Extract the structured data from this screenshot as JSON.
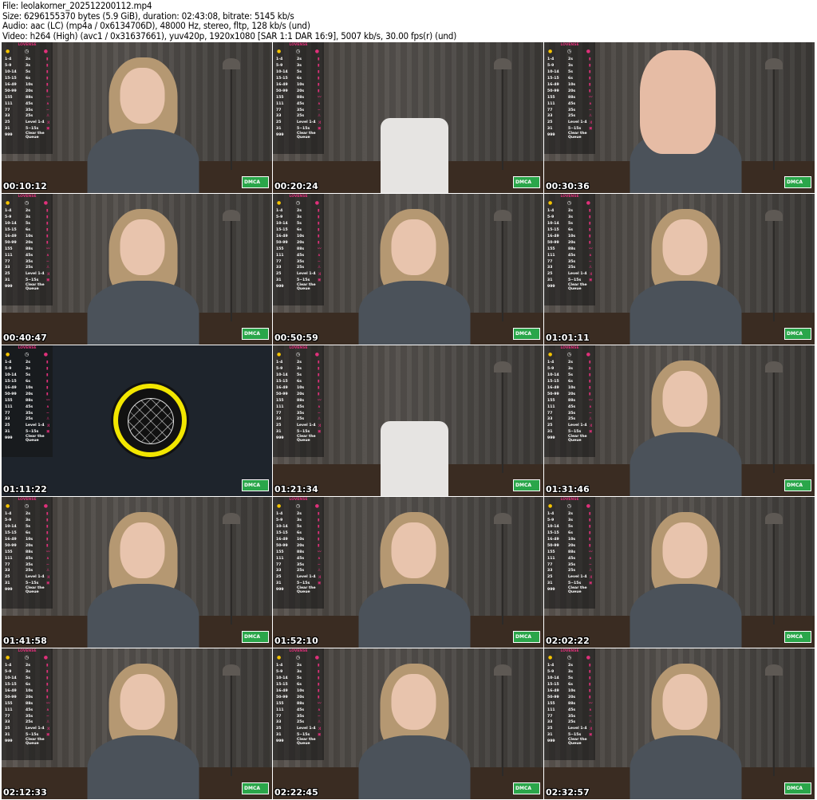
{
  "header": {
    "file": "File: leolakorner_202512200112.mp4",
    "size": "Size: 6296155370 bytes (5.9 GiB), duration: 02:43:08, bitrate: 5145 kb/s",
    "audio": "Audio: aac (LC) (mp4a / 0x6134706D), 48000 Hz, stereo, fltp, 128 kb/s (und)",
    "video": "Video: h264 (High) (avc1 / 0x31637661), yuv420p, 1920x1080 [SAR 1:1 DAR 16:9], 5007 kb/s, 30.00 fps(r) (und)"
  },
  "overlay": {
    "brand": "LOVENSE",
    "menu": [
      [
        "1-4",
        "2s",
        "▮"
      ],
      [
        "5-9",
        "3s",
        "▮"
      ],
      [
        "10-14",
        "5s",
        "▮"
      ],
      [
        "15-15",
        "6s",
        "▮"
      ],
      [
        "16-49",
        "10s",
        "▮"
      ],
      [
        "50-99",
        "20s",
        "▮"
      ],
      [
        "155",
        "88s",
        "〰"
      ],
      [
        "111",
        "45s",
        "∧"
      ],
      [
        "77",
        "35s",
        "~"
      ],
      [
        "33",
        "25s",
        "♙"
      ],
      [
        "25",
        "Level 1-4",
        "⤨"
      ],
      [
        "31",
        "5~15s",
        "▣"
      ],
      [
        "999",
        "Clear the Queue",
        ""
      ]
    ],
    "badge": "DMCA"
  },
  "frames": [
    {
      "time": "00:10:12",
      "scene": "person"
    },
    {
      "time": "00:20:24",
      "scene": "chair"
    },
    {
      "time": "00:30:36",
      "scene": "hand"
    },
    {
      "time": "00:40:47",
      "scene": "person"
    },
    {
      "time": "00:50:59",
      "scene": "person"
    },
    {
      "time": "01:01:11",
      "scene": "person"
    },
    {
      "time": "01:11:22",
      "scene": "logo"
    },
    {
      "time": "01:21:34",
      "scene": "chair"
    },
    {
      "time": "01:31:46",
      "scene": "person"
    },
    {
      "time": "01:41:58",
      "scene": "person"
    },
    {
      "time": "01:52:10",
      "scene": "person"
    },
    {
      "time": "02:02:22",
      "scene": "person"
    },
    {
      "time": "02:12:33",
      "scene": "person"
    },
    {
      "time": "02:22:45",
      "scene": "person"
    },
    {
      "time": "02:32:57",
      "scene": "person"
    }
  ]
}
